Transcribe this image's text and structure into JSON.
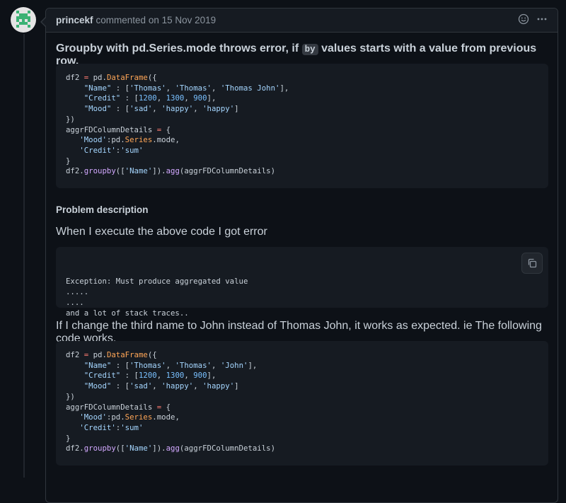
{
  "comment": {
    "author": "princekf",
    "meta": "commented on 15 Nov 2019",
    "actions": [
      {
        "icon": "smiley-icon",
        "glyph": "☺"
      },
      {
        "icon": "kebab-menu-icon",
        "glyph": "···"
      }
    ]
  },
  "body": {
    "title_before": "Groupby with pd.Series.mode throws error, if ",
    "title_code": "by",
    "title_after": " values starts with a value from previous row.",
    "code1": [
      [
        "df2 ",
        [
          "=",
          "kw"
        ],
        " pd.",
        [
          "DataFrame",
          "ob"
        ],
        "({"
      ],
      [
        "    ",
        [
          "\"Name\"",
          "st"
        ],
        " : [",
        [
          "'Thomas'",
          "st"
        ],
        ", ",
        [
          "'Thomas'",
          "st"
        ],
        ", ",
        [
          "'Thomas John'",
          "st"
        ],
        "],"
      ],
      [
        "    ",
        [
          "\"Credit\"",
          "st"
        ],
        " : [",
        [
          "1200",
          "nm"
        ],
        ", ",
        [
          "1300",
          "nm"
        ],
        ", ",
        [
          "900",
          "nm"
        ],
        "],"
      ],
      [
        "    ",
        [
          "\"Mood\"",
          "st"
        ],
        " : [",
        [
          "'sad'",
          "st"
        ],
        ", ",
        [
          "'happy'",
          "st"
        ],
        ", ",
        [
          "'happy'",
          "st"
        ],
        "]"
      ],
      [
        "})"
      ],
      [
        "aggrFDColumnDetails ",
        [
          "=",
          "kw"
        ],
        " {"
      ],
      [
        "   ",
        [
          "'Mood'",
          "st"
        ],
        ":pd.",
        [
          "Series",
          "ob"
        ],
        ".mode,"
      ],
      [
        "   ",
        [
          "'Credit'",
          "st"
        ],
        ":",
        [
          "'sum'",
          "st"
        ]
      ],
      [
        "}"
      ],
      [
        "df2.",
        [
          "groupby",
          "fn"
        ],
        "([",
        [
          "'Name'",
          "st"
        ],
        "]).",
        [
          "agg",
          "fn"
        ],
        "(aggrFDColumnDetails)"
      ]
    ],
    "heading": "Problem description",
    "p2": "When I execute the above code I got error",
    "code2": [
      [
        "Exception: Must produce aggregated value"
      ],
      [
        "....."
      ],
      [
        "...."
      ],
      [
        "and a lot of stack traces.."
      ]
    ],
    "p3": "If I change the third name to John instead of Thomas John, it works as expected. ie The following code works.",
    "code3": [
      [
        "df2 ",
        [
          "=",
          "kw"
        ],
        " pd.",
        [
          "DataFrame",
          "ob"
        ],
        "({"
      ],
      [
        "    ",
        [
          "\"Name\"",
          "st"
        ],
        " : [",
        [
          "'Thomas'",
          "st"
        ],
        ", ",
        [
          "'Thomas'",
          "st"
        ],
        ", ",
        [
          "'John'",
          "st"
        ],
        "],"
      ],
      [
        "    ",
        [
          "\"Credit\"",
          "st"
        ],
        " : [",
        [
          "1200",
          "nm"
        ],
        ", ",
        [
          "1300",
          "nm"
        ],
        ", ",
        [
          "900",
          "nm"
        ],
        "],"
      ],
      [
        "    ",
        [
          "\"Mood\"",
          "st"
        ],
        " : [",
        [
          "'sad'",
          "st"
        ],
        ", ",
        [
          "'happy'",
          "st"
        ],
        ", ",
        [
          "'happy'",
          "st"
        ],
        "]"
      ],
      [
        "})"
      ],
      [
        "aggrFDColumnDetails ",
        [
          "=",
          "kw"
        ],
        " {"
      ],
      [
        "   ",
        [
          "'Mood'",
          "st"
        ],
        ":pd.",
        [
          "Series",
          "ob"
        ],
        ".mode,"
      ],
      [
        "   ",
        [
          "'Credit'",
          "st"
        ],
        ":",
        [
          "'sum'",
          "st"
        ]
      ],
      [
        "}"
      ],
      [
        "df2.",
        [
          "groupby",
          "fn"
        ],
        "([",
        [
          "'Name'",
          "st"
        ],
        "]).",
        [
          "agg",
          "fn"
        ],
        "(aggrFDColumnDetails)"
      ]
    ],
    "copy_icon": "copy-icon"
  },
  "colors": {
    "background": "#0d1117",
    "header": "#161b22",
    "border": "#30363d",
    "code_bg": "#161b22",
    "avatar_green": "#3bb274"
  }
}
